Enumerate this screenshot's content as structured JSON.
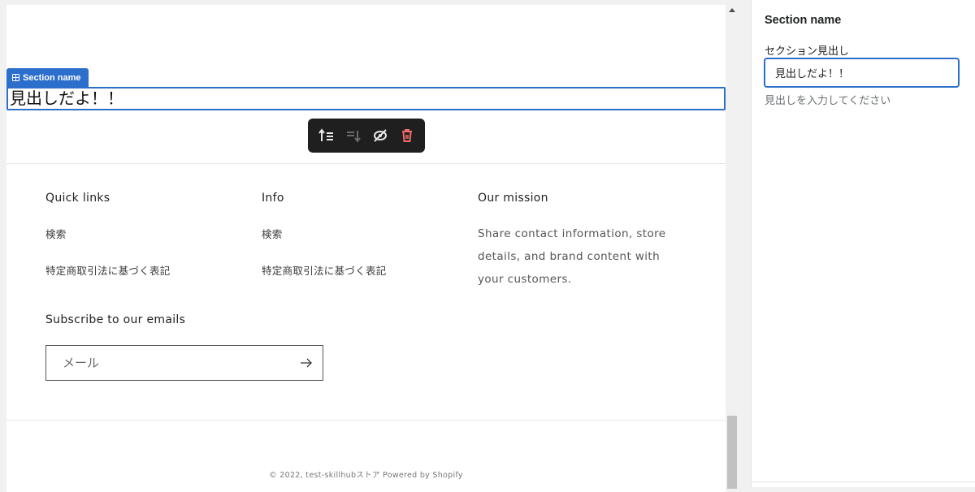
{
  "section": {
    "badge_label": "Section name",
    "heading": "見出しだよ！！"
  },
  "toolbar": {
    "icons": [
      "move-up-icon",
      "move-down-icon",
      "hide-icon",
      "delete-icon"
    ],
    "delete_color": "#f06b6b"
  },
  "footer": {
    "quick_links": {
      "heading": "Quick links",
      "items": [
        "検索",
        "特定商取引法に基づく表記"
      ]
    },
    "info": {
      "heading": "Info",
      "items": [
        "検索",
        "特定商取引法に基づく表記"
      ]
    },
    "mission": {
      "heading": "Our mission",
      "text": "Share contact information, store details, and brand content with your customers."
    },
    "subscribe": {
      "title": "Subscribe to our emails",
      "email_placeholder": "メール"
    },
    "copyright": "© 2022, test-skillhubストア Powered by Shopify"
  },
  "sidebar": {
    "title": "Section name",
    "field_label": "セクション見出し",
    "field_value": "見出しだよ！！",
    "help_text": "見出しを入力してください"
  },
  "colors": {
    "accent": "#2c6ecb",
    "toolbar_bg": "#1f1f1f"
  }
}
